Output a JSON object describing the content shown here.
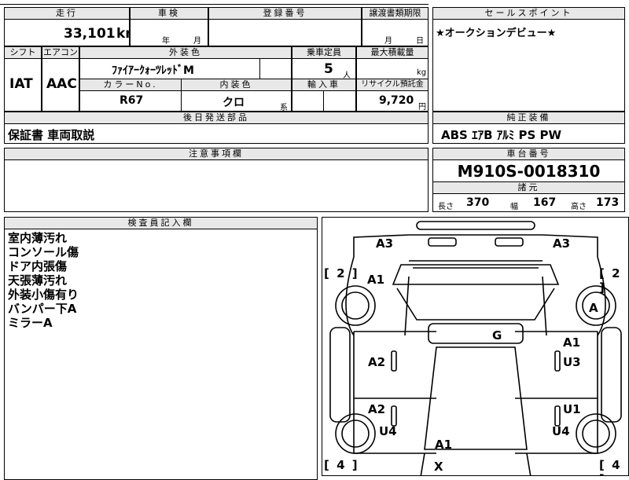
{
  "mileage": {
    "header": "走行",
    "value": "33,101",
    "unit": "km"
  },
  "shaken": {
    "header": "車検",
    "year_unit": "年",
    "month_unit": "月"
  },
  "registration": {
    "header": "登録番号",
    "value": ""
  },
  "transfer_deadline": {
    "header": "譲渡書類期限",
    "month_unit": "月",
    "day_unit": "日"
  },
  "sales_point": {
    "header": "セールスポイント",
    "text": "★オークションデビュー★"
  },
  "shift": {
    "header": "シフト",
    "value": "IAT"
  },
  "aircon": {
    "header": "エアコン",
    "value": "AAC"
  },
  "exterior_color": {
    "header": "外装色",
    "value": "ﾌｧｲｱｰｸｫｰﾂﾚｯﾄﾞM"
  },
  "capacity": {
    "header": "乗車定員",
    "value": "5",
    "unit": "人"
  },
  "max_load": {
    "header": "最大積載量",
    "unit": "kg"
  },
  "color_no": {
    "header": "カラーNo.",
    "value": "R67"
  },
  "interior_color": {
    "header": "内装色",
    "value": "クロ",
    "suffix": "系"
  },
  "import": {
    "header": "輸入車"
  },
  "recycle": {
    "header": "リサイクル預託金",
    "value": "9,720",
    "unit": "円"
  },
  "later_parts": {
    "header": "後日発送部品",
    "text": "保証書 車両取説"
  },
  "genuine_equipment": {
    "header": "純正装備",
    "text": "ABS ｴｱB ｱﾙﾐ PS PW"
  },
  "notes": {
    "header": "注意事項欄",
    "text": ""
  },
  "chassis": {
    "header": "車台番号",
    "value": "M910S-0018310"
  },
  "dimensions": {
    "header": "諸元",
    "length_label": "長さ",
    "length": "370",
    "width_label": "幅",
    "width": "167",
    "height_label": "高さ",
    "height": "173"
  },
  "inspector": {
    "header": "検査員記入欄",
    "lines": [
      "室内薄汚れ",
      "コンソール傷",
      "ドア内張傷",
      "天張薄汚れ",
      "外装小傷有り",
      "バンパー下A",
      "ミラーA"
    ]
  },
  "diagram": {
    "marks": {
      "front_left": "A3",
      "front_right": "A3",
      "fender_left": "A1",
      "wheel_right": "A",
      "roof": "G",
      "door_rf": "A1",
      "door_rf2": "U3",
      "door_lf": "A2",
      "door_lr": "A2",
      "door_rr": "U1",
      "rear_left": "U4",
      "rear_right": "U4",
      "rear": "A1",
      "bumper_rear": "X"
    },
    "brackets": {
      "top_left": "[ 2 ]",
      "top_right": "[ 2 ]",
      "bottom_left": "[ 4 ]",
      "bottom_right": "[ 4 ]"
    }
  }
}
